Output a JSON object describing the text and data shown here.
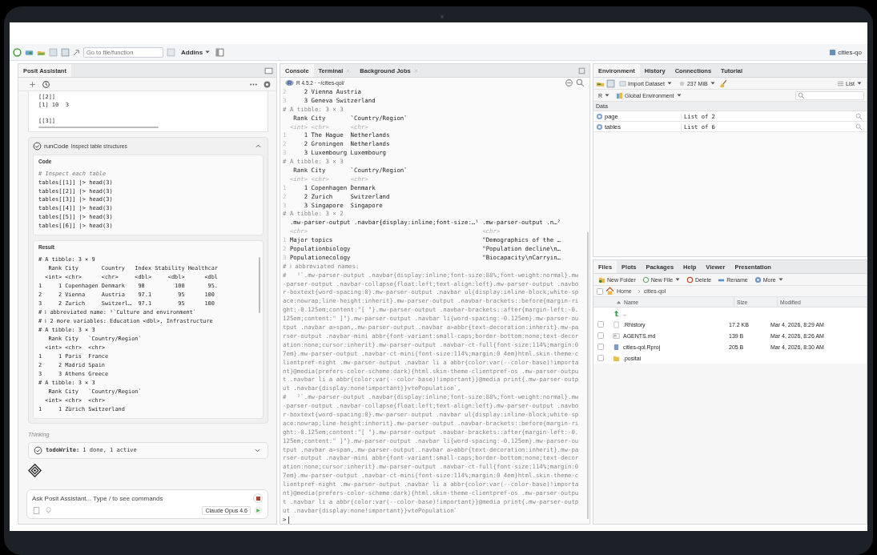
{
  "toolbar": {
    "goto_placeholder": "Go to file/function",
    "addins": "Addins",
    "project": "cities-qo"
  },
  "assistant": {
    "title": "Posit Assistant",
    "prev_output": "[[2]]\n[1] 10  3\n\n[[3]]",
    "tool_call": {
      "name": "runCode",
      "description": "Inspect table structures",
      "expanded": true,
      "code_label": "Code",
      "code_comment": "# Inspect each table",
      "code": "tables[[1]] |> head(3)\ntables[[2]] |> head(3)\ntables[[3]] |> head(3)\ntables[[4]] |> head(3)\ntables[[5]] |> head(3)\ntables[[6]] |> head(3)",
      "result_label": "Result",
      "result": "# A tibble: 3 × 9\n   Rank City       Country   Index Stability Healthcar\n  <int> <chr>      <chr>     <dbl>     <dbl>      <dbl\n1     1 Copenhagen Denmark    98         100       95.\n2     2 Vienna     Austria    97.1        95      100\n3     2 Zurich     Switzerl…  97.1        95      100\n# ℹ abbreviated name: ¹`Culture and environment`\n# ℹ 2 more variables: Education <dbl>, Infrastructure\n# A tibble: 3 × 3\n   Rank City   `Country/Region`\n  <int> <chr>  <chr>\n1     1 Paris  France\n2     2 Madrid Spain\n3     3 Athens Greece\n# A tibble: 3 × 3\n   Rank City   `Country/Region`\n  <int> <chr>  <chr>\n1     1 Zürich Switzerland"
    },
    "status": "Thinking",
    "todo": {
      "text": "**todoWrite:** 1 done, 1 active",
      "expanded": false
    },
    "input": {
      "placeholder": "Ask Posit Assistant... Type / to see commands",
      "model": "Claude Opus 4.6"
    }
  },
  "console": {
    "tabs": [
      {
        "label": "Console",
        "selected": true,
        "closable": false
      },
      {
        "label": "Terminal",
        "selected": false,
        "closable": true
      },
      {
        "label": "Background Jobs",
        "selected": false,
        "closable": true
      }
    ],
    "path": "R 4.5.2 · ~/cities-qol/",
    "lines": [
      {
        "kind": "row",
        "num": "2",
        "text": "     2 Vienna Austria"
      },
      {
        "kind": "row",
        "num": "3",
        "text": "     3 Geneva Switzerland"
      },
      {
        "kind": "comment",
        "text": "# A tibble: 3 × 3"
      },
      {
        "kind": "header",
        "text": "   Rank City       `Country/Region`"
      },
      {
        "kind": "type",
        "text": "  <int> <chr>      <chr>"
      },
      {
        "kind": "row",
        "num": "1",
        "text": "     1 The Hague  Netherlands"
      },
      {
        "kind": "row",
        "num": "2",
        "text": "     2 Groningen  Netherlands"
      },
      {
        "kind": "row",
        "num": "3",
        "text": "     3 Luxembourg Luxembourg"
      },
      {
        "kind": "comment",
        "text": "# A tibble: 3 × 3"
      },
      {
        "kind": "header",
        "text": "   Rank City       `Country/Region`"
      },
      {
        "kind": "type",
        "text": "  <int> <chr>      <chr>"
      },
      {
        "kind": "row",
        "num": "1",
        "text": "     1 Copenhagen Denmark"
      },
      {
        "kind": "row",
        "num": "2",
        "text": "     2 Zurich     Switzerland"
      },
      {
        "kind": "row",
        "num": "3",
        "text": "     3 Singapore  Singapore"
      },
      {
        "kind": "comment",
        "text": "# A tibble: 3 × 2"
      },
      {
        "kind": "header",
        "text": "  .mw-parser-output .navbar{display:inline;font-size:…¹ .mw-parser-output .n…²"
      },
      {
        "kind": "type",
        "text": "  <chr>                                                 <chr>"
      },
      {
        "kind": "row",
        "num": "1",
        "text": " Major topics                                          \"Demographics of the …"
      },
      {
        "kind": "row",
        "num": "2",
        "text": " Populationbiology                                     \"Population decline\\n…"
      },
      {
        "kind": "row",
        "num": "3",
        "text": " Populationecology                                     \"Biocapacity\\nCarryin…"
      },
      {
        "kind": "comment",
        "text": "# ℹ abbreviated names:"
      },
      {
        "kind": "comment",
        "text": "#   ¹`.mw-parser-output .navbar{display:inline;font-size:88%;font-weight:normal}.mw"
      },
      {
        "kind": "comment",
        "text": "-parser-output .navbar-collapse{float:left;text-align:left}.mw-parser-output .navbo"
      },
      {
        "kind": "comment",
        "text": "r-boxtext{word-spacing:0}.mw-parser-output .navbar ul{display:inline-block;white-sp"
      },
      {
        "kind": "comment",
        "text": "ace:nowrap;line-height:inherit}.mw-parser-output .navbar-brackets::before{margin-ri"
      },
      {
        "kind": "comment",
        "text": "ght:-0.125em;content:\"[ \"}.mw-parser-output .navbar-brackets::after{margin-left:-0."
      },
      {
        "kind": "comment",
        "text": "125em;content:\" ]\"}.mw-parser-output .navbar li{word-spacing:-0.125em}.mw-parser-ou"
      },
      {
        "kind": "comment",
        "text": "tput .navbar a>span,.mw-parser-output .navbar a>abbr{text-decoration:inherit}.mw-pa"
      },
      {
        "kind": "comment",
        "text": "rser-output .navbar-mini abbr{font-variant:small-caps;border-bottom:none;text-decor"
      },
      {
        "kind": "comment",
        "text": "ation:none;cursor:inherit}.mw-parser-output .navbar-ct-full{font-size:114%;margin:0"
      },
      {
        "kind": "comment",
        "text": "7em}.mw-parser-output .navbar-ct-mini{font-size:114%;margin:0 4em}html.skin-theme-c"
      },
      {
        "kind": "comment",
        "text": "lientpref-night .mw-parser-output .navbar li a abbr{color:var(--color-base)!importa"
      },
      {
        "kind": "comment",
        "text": "nt}@media(prefers-color-scheme:dark){html.skin-theme-clientpref-os .mw-parser-outpu"
      },
      {
        "kind": "comment",
        "text": "t .navbar li a abbr{color:var(--color-base)!important}}@media print{.mw-parser-outp"
      },
      {
        "kind": "comment",
        "text": "ut .navbar{display:none!important}}vtePopulation`,"
      },
      {
        "kind": "comment",
        "text": "#   ²`.mw-parser-output .navbar{display:inline;font-size:88%;font-weight:normal}.mw"
      },
      {
        "kind": "comment",
        "text": "-parser-output .navbar-collapse{float:left;text-align:left}.mw-parser-output .navbo"
      },
      {
        "kind": "comment",
        "text": "r-boxtext{word-spacing:0}.mw-parser-output .navbar ul{display:inline-block;white-sp"
      },
      {
        "kind": "comment",
        "text": "ace:nowrap;line-height:inherit}.mw-parser-output .navbar-brackets::before{margin-ri"
      },
      {
        "kind": "comment",
        "text": "ght:-0.125em;content:\"[ \"}.mw-parser-output .navbar-brackets::after{margin-left:-0."
      },
      {
        "kind": "comment",
        "text": "125em;content:\" ]\"}.mw-parser-output .navbar li{word-spacing:-0.125em}.mw-parser-ou"
      },
      {
        "kind": "comment",
        "text": "tput .navbar a>span,.mw-parser-output .navbar a>abbr{text-decoration:inherit}.mw-pa"
      },
      {
        "kind": "comment",
        "text": "rser-output .navbar-mini abbr{font-variant:small-caps;border-bottom:none;text-decor"
      },
      {
        "kind": "comment",
        "text": "ation:none;cursor:inherit}.mw-parser-output .navbar-ct-full{font-size:114%;margin:0"
      },
      {
        "kind": "comment",
        "text": "7em}.mw-parser-output .navbar-ct-mini{font-size:114%;margin:0 4em}html.skin-theme-c"
      },
      {
        "kind": "comment",
        "text": "lientpref-night .mw-parser-output .navbar li a abbr{color:var(--color-base)!importa"
      },
      {
        "kind": "comment",
        "text": "nt}@media(prefers-color-scheme:dark){html.skin-theme-clientpref-os .mw-parser-outpu"
      },
      {
        "kind": "comment",
        "text": "t .navbar li a abbr{color:var(--color-base)!important}}@media print{.mw-parser-outp"
      },
      {
        "kind": "comment",
        "text": "ut .navbar{display:none!important}}vtePopulation`"
      },
      {
        "kind": "prompt",
        "text": ">"
      }
    ]
  },
  "environment": {
    "tabs": [
      {
        "label": "Environment",
        "selected": true
      },
      {
        "label": "History",
        "selected": false
      },
      {
        "label": "Connections",
        "selected": false
      },
      {
        "label": "Tutorial",
        "selected": false
      }
    ],
    "import": "Import Dataset",
    "memory": "237 MiB",
    "view": "List",
    "language": "R",
    "scope": "Global Environment",
    "section": "Data",
    "rows": [
      {
        "name": "page",
        "value": "List of  2"
      },
      {
        "name": "tables",
        "value": "List of  6"
      }
    ]
  },
  "files": {
    "tabs": [
      {
        "label": "Files",
        "selected": true
      },
      {
        "label": "Plots",
        "selected": false
      },
      {
        "label": "Packages",
        "selected": false
      },
      {
        "label": "Help",
        "selected": false
      },
      {
        "label": "Viewer",
        "selected": false
      },
      {
        "label": "Presentation",
        "selected": false
      }
    ],
    "actions": [
      {
        "kind": "new-folder",
        "label": "New Folder",
        "dropdown": false
      },
      {
        "kind": "new-file",
        "label": "New File",
        "dropdown": true
      },
      {
        "kind": "delete",
        "label": "Delete",
        "dropdown": false
      },
      {
        "kind": "rename",
        "label": "Rename",
        "dropdown": false
      },
      {
        "kind": "more",
        "label": "More",
        "dropdown": true
      }
    ],
    "select_all_checked": false,
    "breadcrumb": [
      "Home",
      "cities-qol"
    ],
    "columns": [
      "Name",
      "Size",
      "Modified"
    ],
    "rows": [
      {
        "kind": "parent",
        "name": ".."
      },
      {
        "kind": "history",
        "name": ".Rhistory",
        "size": "17.2 KB",
        "modified": "Mar 4, 2026, 8:29 AM",
        "checked": false
      },
      {
        "kind": "markdown",
        "name": "AGENTS.md",
        "size": "139 B",
        "modified": "Mar 4, 2026, 8:26 AM",
        "checked": false
      },
      {
        "kind": "project",
        "name": "cities-qol.Rproj",
        "size": "205 B",
        "modified": "Mar 4, 2026, 8:30 AM",
        "checked": false
      },
      {
        "kind": "folder",
        "name": ".positai",
        "checked": false
      }
    ]
  }
}
